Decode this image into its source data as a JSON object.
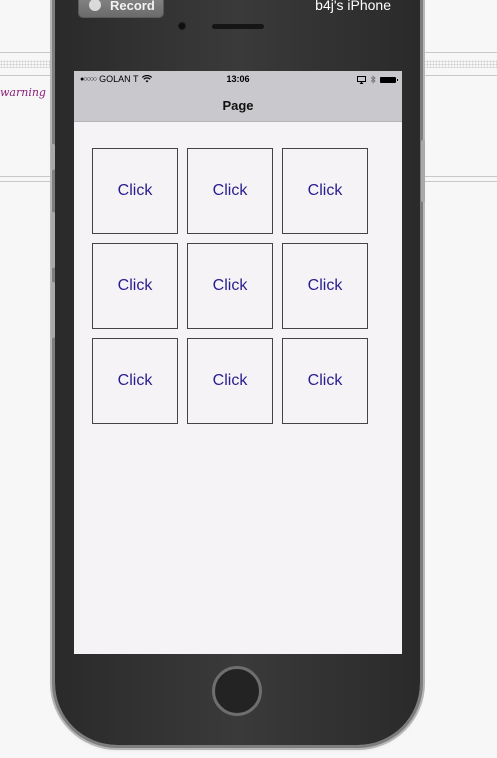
{
  "background": {
    "warning_text": "warning #"
  },
  "simulator": {
    "record_label": "Record",
    "device_name": "b4j's iPhone"
  },
  "status_bar": {
    "carrier": "GOLAN T",
    "time": "13:06"
  },
  "nav_bar": {
    "title": "Page"
  },
  "grid": {
    "cells": [
      {
        "label": "Click"
      },
      {
        "label": "Click"
      },
      {
        "label": "Click"
      },
      {
        "label": "Click"
      },
      {
        "label": "Click"
      },
      {
        "label": "Click"
      },
      {
        "label": "Click"
      },
      {
        "label": "Click"
      },
      {
        "label": "Click"
      }
    ]
  },
  "colors": {
    "button_text": "#271d8e",
    "nav_bar_bg": "#c9c8cc",
    "screen_bg": "#f6f3f7"
  }
}
